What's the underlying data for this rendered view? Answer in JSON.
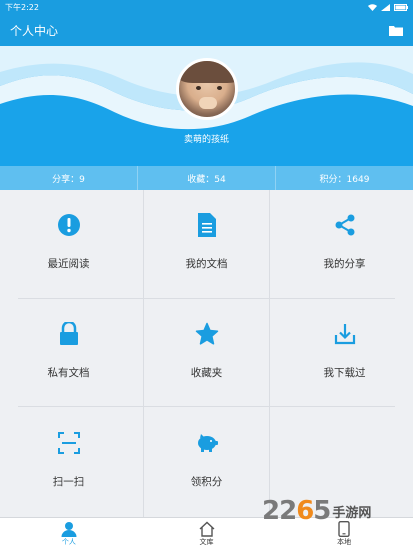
{
  "status_bar": {
    "time": "下午2:22"
  },
  "header": {
    "title": "个人中心"
  },
  "profile": {
    "username": "卖萌的孩纸"
  },
  "stats": [
    {
      "label": "分享：9"
    },
    {
      "label": "收藏：54"
    },
    {
      "label": "积分：1649"
    }
  ],
  "menu": [
    {
      "label": "最近阅读",
      "icon": "exclamation-icon"
    },
    {
      "label": "我的文档",
      "icon": "document-icon"
    },
    {
      "label": "我的分享",
      "icon": "share-icon"
    },
    {
      "label": "私有文档",
      "icon": "lock-icon"
    },
    {
      "label": "收藏夹",
      "icon": "star-icon"
    },
    {
      "label": "我下载过",
      "icon": "download-icon"
    },
    {
      "label": "扫一扫",
      "icon": "scan-icon"
    },
    {
      "label": "领积分",
      "icon": "piggy-bank-icon"
    }
  ],
  "tabs": [
    {
      "label": "个人",
      "icon": "person-icon",
      "active": true
    },
    {
      "label": "文库",
      "icon": "home-icon",
      "active": false
    },
    {
      "label": "本地",
      "icon": "phone-icon",
      "active": false
    }
  ],
  "watermark": {
    "number": "2265",
    "text": "手游网"
  },
  "colors": {
    "primary": "#1a9de0",
    "stats_bar": "#5fbff0",
    "grid_bg": "#eef0f3"
  }
}
